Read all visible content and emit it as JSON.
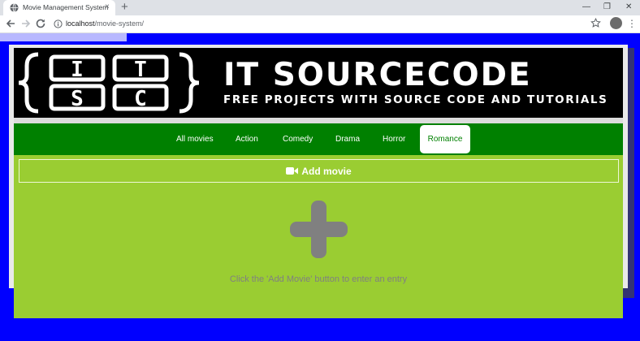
{
  "browser": {
    "tab_title": "Movie Management System",
    "tab_close": "×",
    "new_tab": "+",
    "url_host": "localhost",
    "url_path": "/movie-system/",
    "window_controls": {
      "minimize": "—",
      "restore": "❐",
      "close": "✕"
    },
    "menu": "⋮"
  },
  "banner": {
    "logo_letters": [
      "I",
      "T",
      "S",
      "C"
    ],
    "brand": "IT SOURCECODE",
    "tagline": "FREE PROJECTS WITH SOURCE CODE AND TUTORIALS"
  },
  "nav": {
    "items": [
      {
        "label": "All movies",
        "active": false
      },
      {
        "label": "Action",
        "active": false
      },
      {
        "label": "Comedy",
        "active": false
      },
      {
        "label": "Drama",
        "active": false
      },
      {
        "label": "Horror",
        "active": false
      },
      {
        "label": "Romance",
        "active": true
      }
    ]
  },
  "main": {
    "add_button_label": "Add movie",
    "add_button_icon": "video-camera-icon",
    "empty_icon": "plus-icon",
    "empty_message": "Click the 'Add Movie' button to enter an entry"
  },
  "colors": {
    "page_background": "#0000ff",
    "nav_background": "#008000",
    "content_background": "#9acd32",
    "plus_icon": "#808080"
  }
}
